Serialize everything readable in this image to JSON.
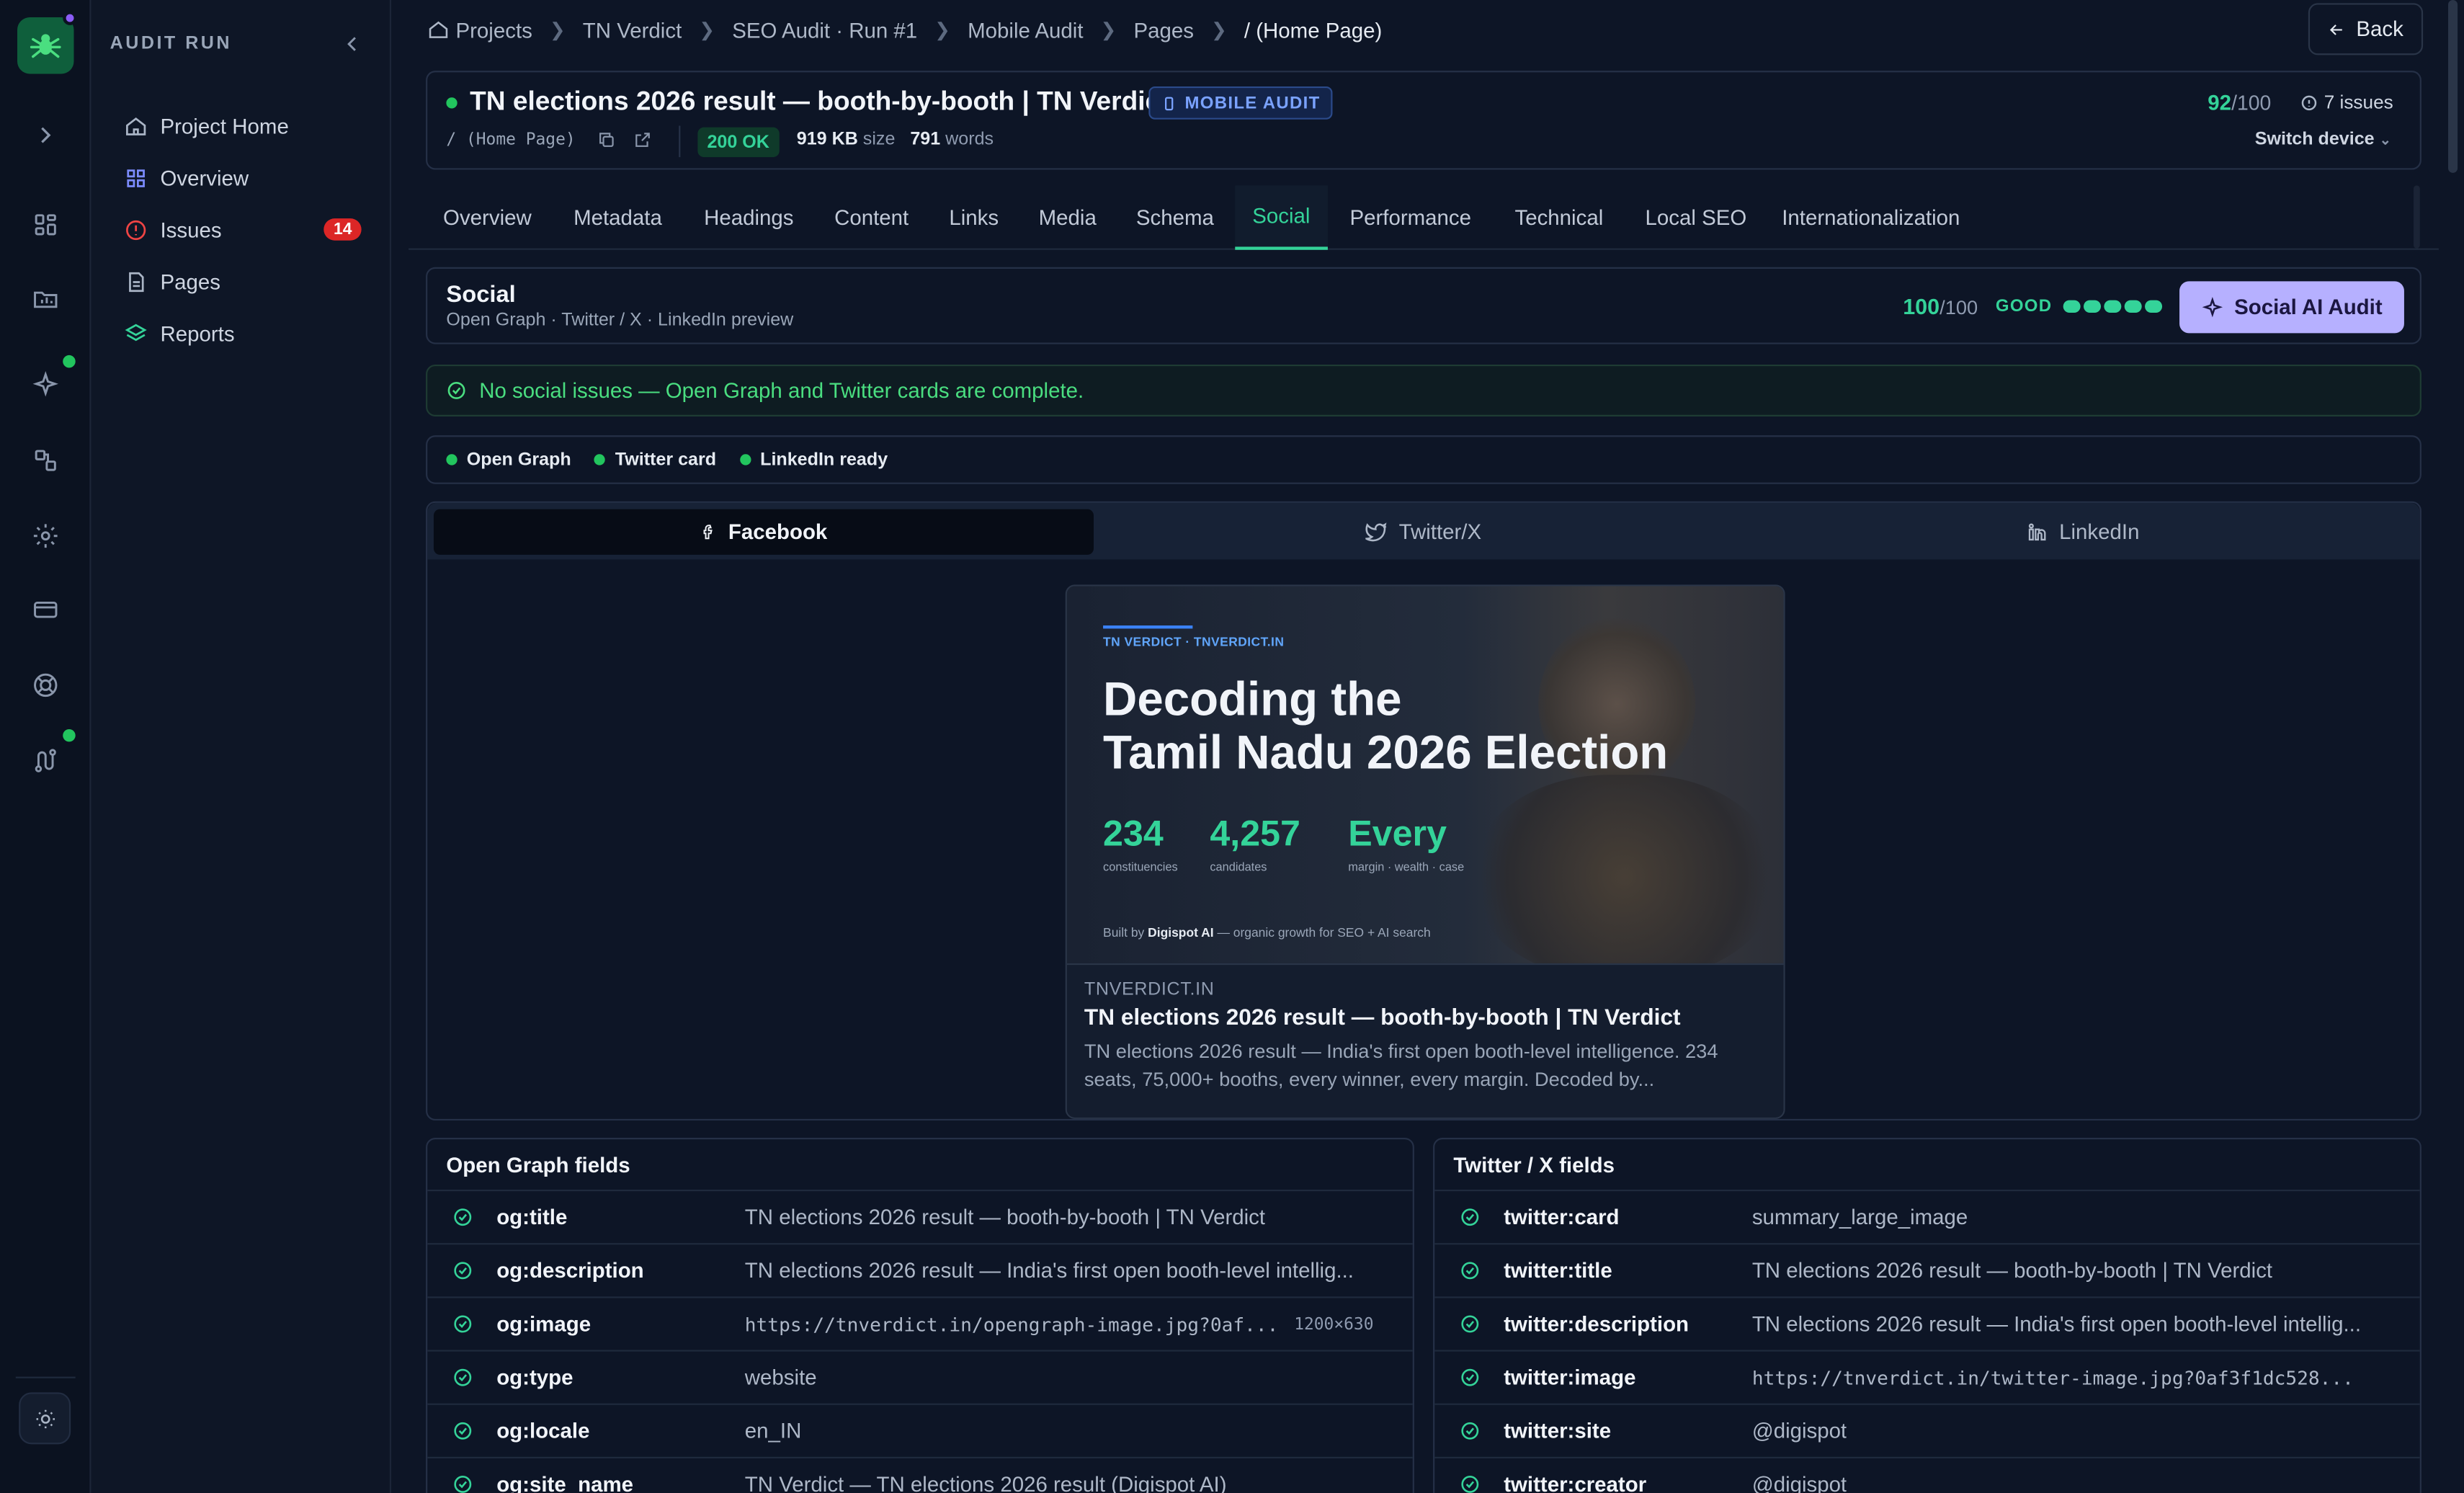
{
  "sidebar": {
    "title": "AUDIT RUN",
    "items": [
      {
        "label": "Project Home"
      },
      {
        "label": "Overview"
      },
      {
        "label": "Issues",
        "badge": "14"
      },
      {
        "label": "Pages"
      },
      {
        "label": "Reports"
      }
    ]
  },
  "breadcrumbs": [
    "Projects",
    "TN Verdict",
    "SEO Audit · Run #1",
    "Mobile Audit",
    "Pages",
    "/ (Home Page)"
  ],
  "back_label": "Back",
  "page": {
    "title": "TN elections 2026 result — booth-by-booth | TN Verdict",
    "tag": "MOBILE AUDIT",
    "path": "/ (Home Page)",
    "status": "200 OK",
    "size_value": "919 KB",
    "size_label": "size",
    "words_value": "791",
    "words_label": "words",
    "score": "92",
    "score_max": "/100",
    "issues": "7 issues",
    "switch_device": "Switch device"
  },
  "tabs": [
    "Overview",
    "Metadata",
    "Headings",
    "Content",
    "Links",
    "Media",
    "Schema",
    "Social",
    "Performance",
    "Technical",
    "Local SEO",
    "Internationalization"
  ],
  "active_tab": "Social",
  "social": {
    "title": "Social",
    "subtitle": "Open Graph · Twitter / X · LinkedIn preview",
    "score": "100",
    "score_max": "/100",
    "grade": "GOOD",
    "ai_button": "Social AI Audit",
    "alert": "No social issues — Open Graph and Twitter cards are complete.",
    "chips": [
      "Open Graph",
      "Twitter card",
      "LinkedIn ready"
    ]
  },
  "preview_tabs": [
    "Facebook",
    "Twitter/X",
    "LinkedIn"
  ],
  "preview": {
    "img_brand": "TN VERDICT · TNVERDICT.IN",
    "img_heading_1": "Decoding the",
    "img_heading_2": "Tamil Nadu 2026 Election",
    "stats": [
      {
        "value": "234",
        "label": "constituencies"
      },
      {
        "value": "4,257",
        "label": "candidates"
      },
      {
        "value": "Every",
        "label": "margin · wealth · case"
      }
    ],
    "built_prefix": "Built by",
    "built_brand": "Digispot AI",
    "built_suffix": "— organic growth for SEO + AI search",
    "domain": "TNVERDICT.IN",
    "title": "TN elections 2026 result — booth-by-booth | TN Verdict",
    "description": "TN elections 2026 result — India's first open booth-level intelligence. 234 seats, 75,000+ booths, every winner, every margin. Decoded by..."
  },
  "og_fields": {
    "title": "Open Graph fields",
    "rows": [
      {
        "key": "og:title",
        "value": "TN elections 2026 result — booth-by-booth | TN Verdict"
      },
      {
        "key": "og:description",
        "value": "TN elections 2026 result — India's first open booth-level intellig..."
      },
      {
        "key": "og:image",
        "value": "https://tnverdict.in/opengraph-image.jpg?0af...",
        "extra": "1200×630"
      },
      {
        "key": "og:type",
        "value": "website"
      },
      {
        "key": "og:locale",
        "value": "en_IN"
      },
      {
        "key": "og:site_name",
        "value": "TN Verdict — TN elections 2026 result (Digispot AI)"
      }
    ]
  },
  "tw_fields": {
    "title": "Twitter / X fields",
    "rows": [
      {
        "key": "twitter:card",
        "value": "summary_large_image"
      },
      {
        "key": "twitter:title",
        "value": "TN elections 2026 result — booth-by-booth | TN Verdict"
      },
      {
        "key": "twitter:description",
        "value": "TN elections 2026 result — India's first open booth-level intellig..."
      },
      {
        "key": "twitter:image",
        "value": "https://tnverdict.in/twitter-image.jpg?0af3f1dc528..."
      },
      {
        "key": "twitter:site",
        "value": "@digispot"
      },
      {
        "key": "twitter:creator",
        "value": "@digispot"
      }
    ]
  },
  "colors": {
    "accent": "#34d399",
    "brand_tag": "#7aa2ff",
    "ai_button": "#b6b0ff",
    "badge": "#dc2626"
  }
}
